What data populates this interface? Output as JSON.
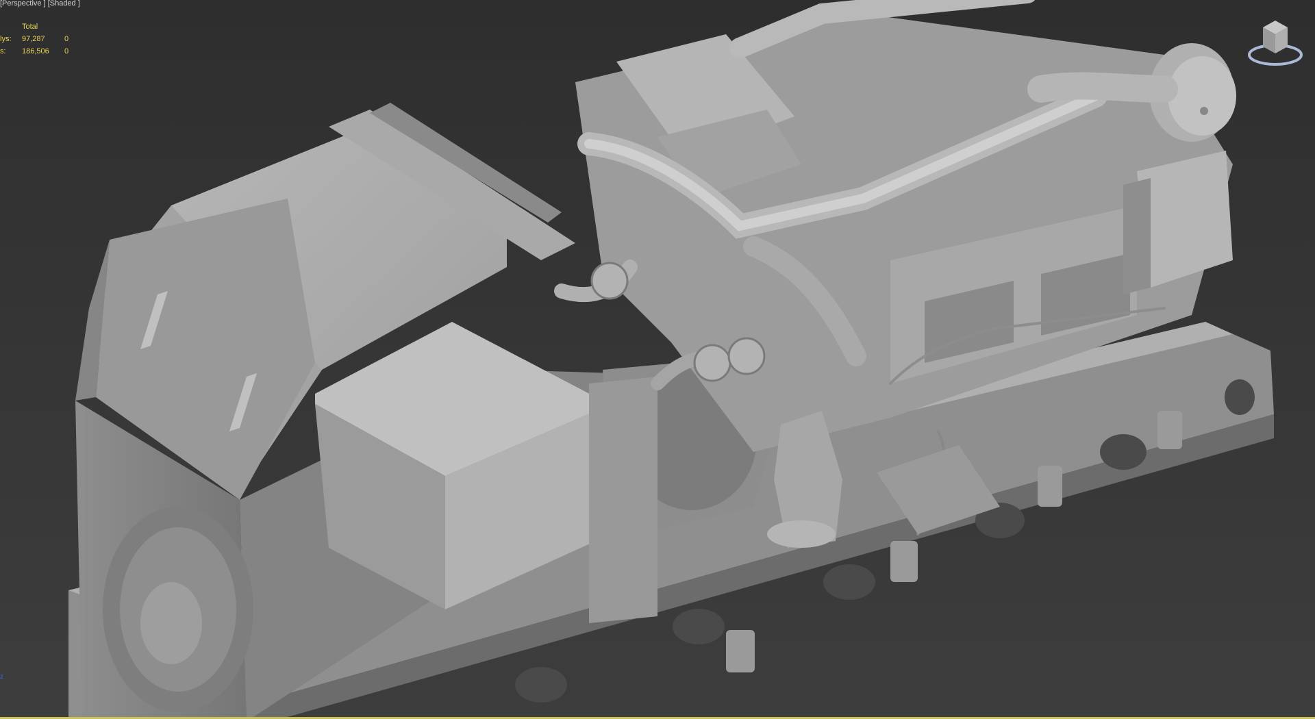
{
  "viewport": {
    "label": "[Perspective ] [Shaded ]",
    "active_border_color": "#c9c35a"
  },
  "stats": {
    "header": "Total",
    "rows": [
      {
        "label": "lys:",
        "total": "97,287",
        "selected": "0"
      },
      {
        "label": "s:",
        "total": "186,506",
        "selected": "0"
      }
    ],
    "color": "#e8d35a"
  },
  "axis_indicator": {
    "label": "z"
  },
  "viewcube": {
    "icon": "viewcube-icon"
  },
  "scene": {
    "model_icon": "generator-model",
    "shading_color": "#a8a8a8"
  }
}
